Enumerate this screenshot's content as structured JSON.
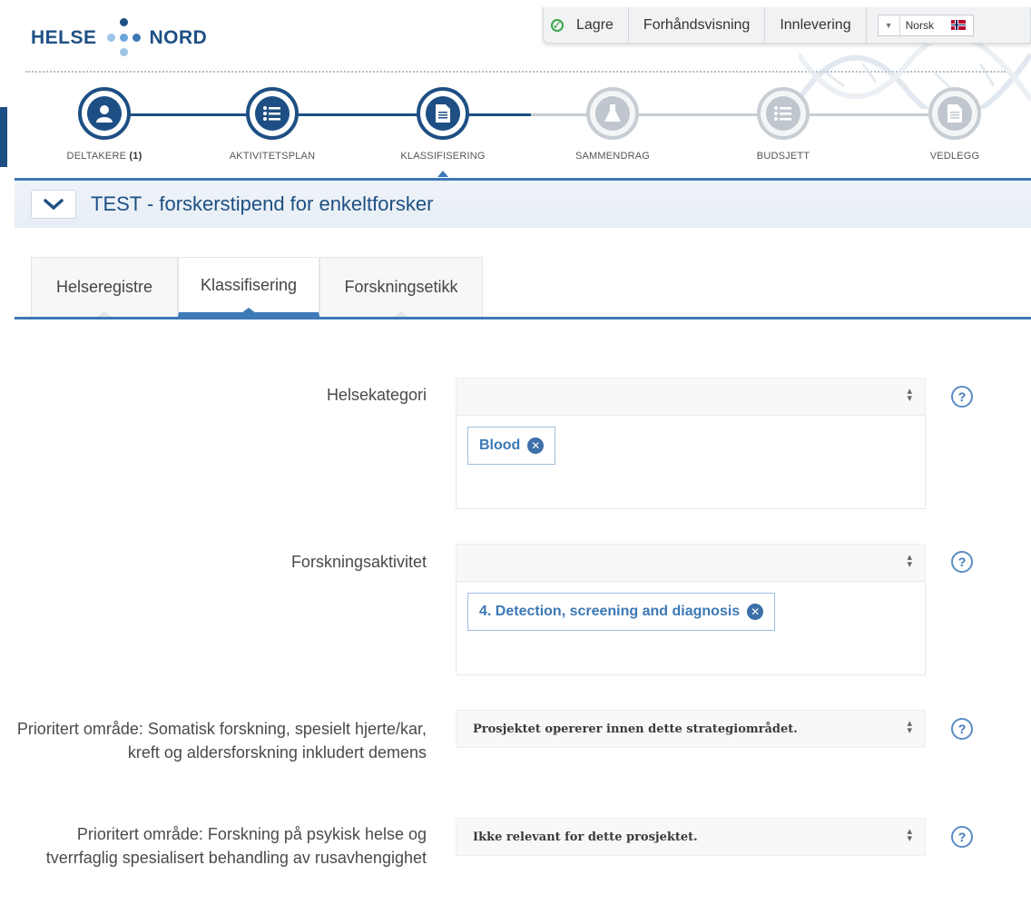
{
  "logo": {
    "left_text": "HELSE",
    "right_text": "NORD"
  },
  "toolbar": {
    "save": "Lagre",
    "preview": "Forhåndsvisning",
    "submit": "Innlevering",
    "language": "Norsk"
  },
  "steps": [
    {
      "label": "DELTAKERE",
      "count": "(1)",
      "icon": "person-icon",
      "state": "active"
    },
    {
      "label": "AKTIVITETSPLAN",
      "icon": "list-icon",
      "state": "active"
    },
    {
      "label": "KLASSIFISERING",
      "icon": "document-icon",
      "state": "active"
    },
    {
      "label": "SAMMENDRAG",
      "icon": "flask-icon",
      "state": "inactive"
    },
    {
      "label": "BUDSJETT",
      "icon": "list-icon",
      "state": "inactive"
    },
    {
      "label": "VEDLEGG",
      "icon": "document-icon",
      "state": "inactive"
    }
  ],
  "project": {
    "title": "TEST - forskerstipend for enkeltforsker"
  },
  "tabs": [
    {
      "label": "Helseregistre"
    },
    {
      "label": "Klassifisering",
      "selected": true
    },
    {
      "label": "Forskningsetikk"
    }
  ],
  "form": {
    "health_category": {
      "label": "Helsekategori",
      "value": "",
      "tag": "Blood"
    },
    "research_activity": {
      "label": "Forskningsaktivitet",
      "value": "",
      "tag": "4. Detection, screening and diagnosis"
    },
    "priority_somatic": {
      "label": "Prioritert område: Somatisk forskning, spesielt hjerte/kar, kreft og aldersforskning inkludert demens",
      "value": "Prosjektet opererer innen dette strategiområdet."
    },
    "priority_mental": {
      "label": "Prioritert område: Forskning på psykisk helse og tverrfaglig spesialisert behandling av rusavhengighet",
      "value": "Ikke relevant for dette prosjektet."
    },
    "help_symbol": "?"
  },
  "colors": {
    "brand_blue": "#1e4f84",
    "accent_blue": "#3d78b7",
    "inactive_gray": "#c0c6cd",
    "save_green": "#38a848"
  }
}
